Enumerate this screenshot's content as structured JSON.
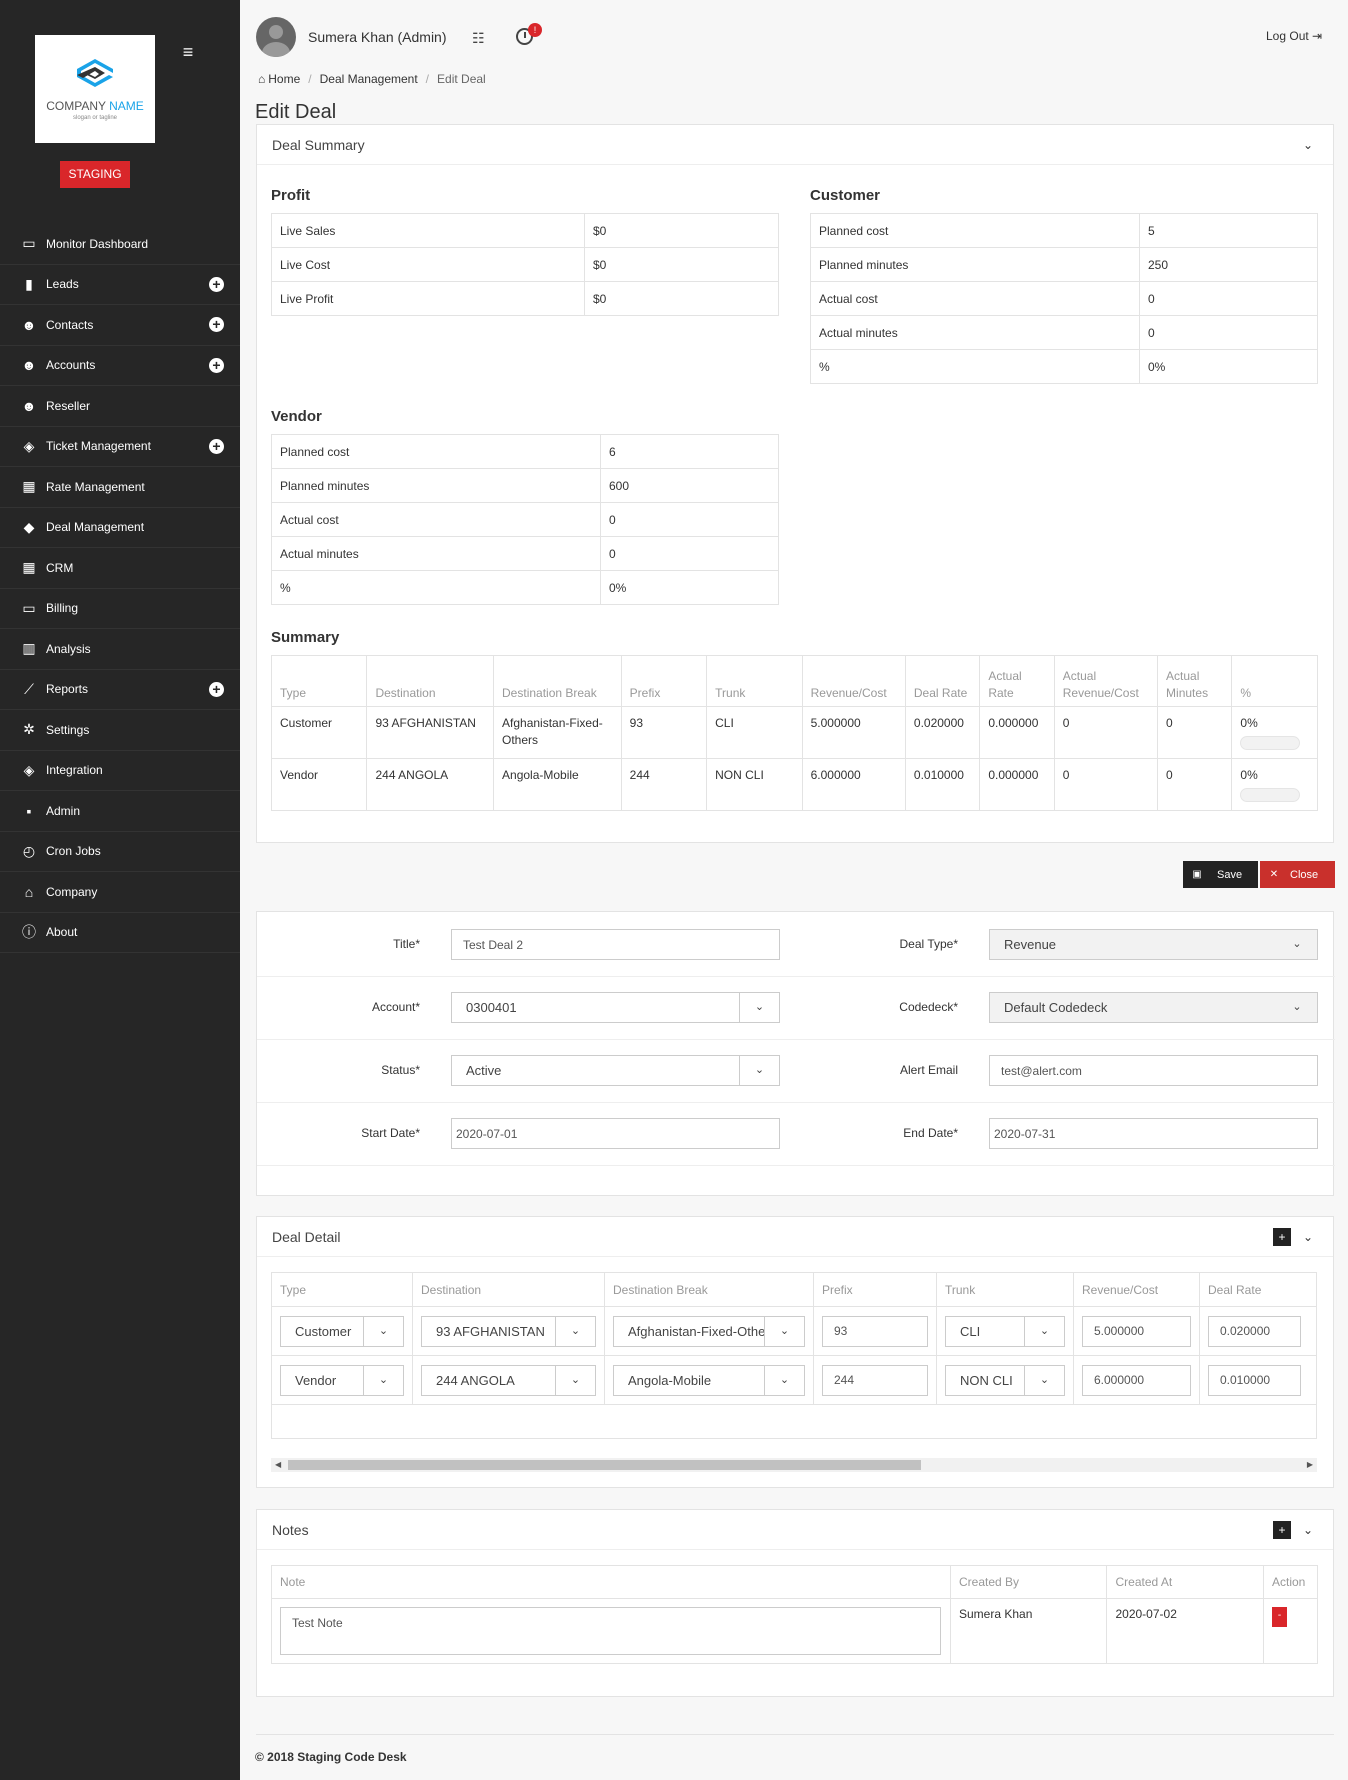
{
  "sidebar": {
    "logo_word1": "COMPANY",
    "logo_word2": "NAME",
    "logo_tagline": "slogan or tagline",
    "env_badge": "STAGING",
    "items": [
      {
        "label": "Monitor Dashboard",
        "icon": "monitor-icon",
        "plus": false
      },
      {
        "label": "Leads",
        "icon": "building-icon",
        "plus": true
      },
      {
        "label": "Contacts",
        "icon": "users-icon",
        "plus": true
      },
      {
        "label": "Accounts",
        "icon": "group-icon",
        "plus": true
      },
      {
        "label": "Reseller",
        "icon": "users-icon",
        "plus": false
      },
      {
        "label": "Ticket Management",
        "icon": "ticket-icon",
        "plus": true
      },
      {
        "label": "Rate Management",
        "icon": "table-icon",
        "plus": false
      },
      {
        "label": "Deal Management",
        "icon": "tag-icon",
        "plus": false
      },
      {
        "label": "CRM",
        "icon": "grid-icon",
        "plus": false
      },
      {
        "label": "Billing",
        "icon": "credit-card-icon",
        "plus": false
      },
      {
        "label": "Analysis",
        "icon": "bar-chart-icon",
        "plus": false
      },
      {
        "label": "Reports",
        "icon": "line-chart-icon",
        "plus": true
      },
      {
        "label": "Settings",
        "icon": "gears-icon",
        "plus": false
      },
      {
        "label": "Integration",
        "icon": "cube-icon",
        "plus": false
      },
      {
        "label": "Admin",
        "icon": "lock-icon",
        "plus": false
      },
      {
        "label": "Cron Jobs",
        "icon": "clock-icon",
        "plus": false
      },
      {
        "label": "Company",
        "icon": "home-icon",
        "plus": false
      },
      {
        "label": "About",
        "icon": "info-icon",
        "plus": false
      }
    ]
  },
  "topbar": {
    "user": "Sumera Khan (Admin)",
    "notification_count": "!",
    "logout": "Log Out"
  },
  "breadcrumb": {
    "home": "Home",
    "section": "Deal Management",
    "current": "Edit Deal"
  },
  "page_title": "Edit Deal",
  "summary_panel": {
    "title": "Deal Summary",
    "profit": {
      "title": "Profit",
      "rows": [
        [
          "Live Sales",
          "$0"
        ],
        [
          "Live Cost",
          "$0"
        ],
        [
          "Live Profit",
          "$0"
        ]
      ]
    },
    "customer": {
      "title": "Customer",
      "rows": [
        [
          "Planned cost",
          "5"
        ],
        [
          "Planned minutes",
          "250"
        ],
        [
          "Actual cost",
          "0"
        ],
        [
          "Actual minutes",
          "0"
        ],
        [
          "%",
          "0%"
        ]
      ]
    },
    "vendor": {
      "title": "Vendor",
      "rows": [
        [
          "Planned cost",
          "6"
        ],
        [
          "Planned minutes",
          "600"
        ],
        [
          "Actual cost",
          "0"
        ],
        [
          "Actual minutes",
          "0"
        ],
        [
          "%",
          "0%"
        ]
      ]
    },
    "summary": {
      "title": "Summary",
      "headers": [
        "Type",
        "Destination",
        "Destination Break",
        "Prefix",
        "Trunk",
        "Revenue/Cost",
        "Deal Rate",
        "Actual Rate",
        "Actual Revenue/Cost",
        "Actual Minutes",
        "%"
      ],
      "rows": [
        [
          "Customer",
          "93 AFGHANISTAN",
          "Afghanistan-Fixed-Others",
          "93",
          "CLI",
          "5.000000",
          "0.020000",
          "0.000000",
          "0",
          "0",
          "0%"
        ],
        [
          "Vendor",
          "244 ANGOLA",
          "Angola-Mobile",
          "244",
          "NON CLI",
          "6.000000",
          "0.010000",
          "0.000000",
          "0",
          "0",
          "0%"
        ]
      ],
      "progress": [
        0,
        0
      ]
    }
  },
  "actions": {
    "save": "Save",
    "close": "Close"
  },
  "form": {
    "title_label": "Title*",
    "title_value": "Test Deal 2",
    "deal_type_label": "Deal Type*",
    "deal_type_value": "Revenue",
    "account_label": "Account*",
    "account_value": "0300401",
    "codedeck_label": "Codedeck*",
    "codedeck_value": "Default Codedeck",
    "status_label": "Status*",
    "status_value": "Active",
    "alert_label": "Alert Email",
    "alert_value": "test@alert.com",
    "start_label": "Start Date*",
    "start_value": "2020-07-01",
    "end_label": "End Date*",
    "end_value": "2020-07-31"
  },
  "deal_detail": {
    "title": "Deal Detail",
    "headers": [
      "Type",
      "Destination",
      "Destination Break",
      "Prefix",
      "Trunk",
      "Revenue/Cost",
      "Deal Rate"
    ],
    "rows": [
      {
        "type": "Customer",
        "destination": "93 AFGHANISTAN",
        "break": "Afghanistan-Fixed-Others",
        "prefix": "93",
        "trunk": "CLI",
        "revenue": "5.000000",
        "rate": "0.020000"
      },
      {
        "type": "Vendor",
        "destination": "244 ANGOLA",
        "break": "Angola-Mobile",
        "prefix": "244",
        "trunk": "NON CLI",
        "revenue": "6.000000",
        "rate": "0.010000"
      }
    ]
  },
  "notes": {
    "title": "Notes",
    "headers": [
      "Note",
      "Created By",
      "Created At",
      "Action"
    ],
    "rows": [
      {
        "note": "Test Note",
        "by": "Sumera Khan",
        "at": "2020-07-02",
        "action": "-"
      }
    ]
  },
  "footer": "© 2018 Staging Code Desk"
}
